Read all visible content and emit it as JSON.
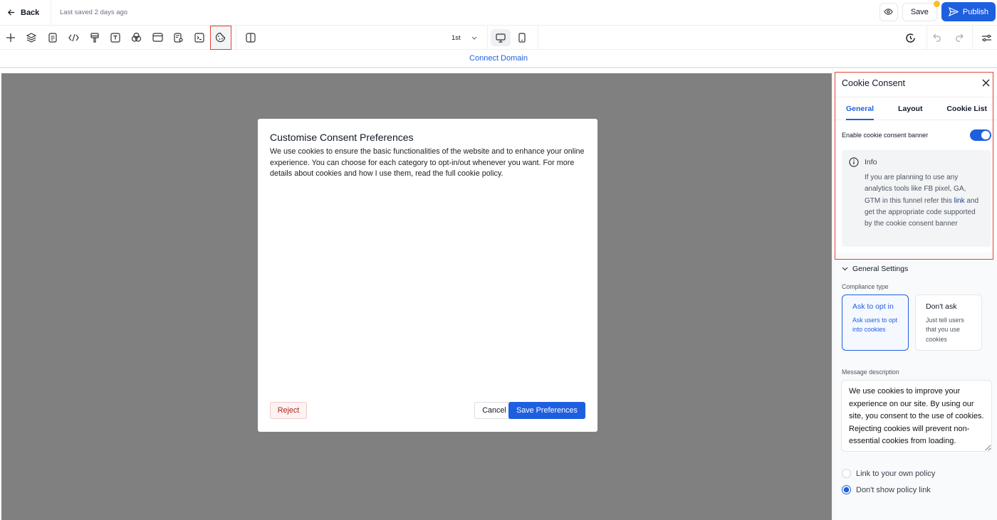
{
  "header": {
    "back_label": "Back",
    "last_saved": "Last saved 2 days ago",
    "save_label": "Save",
    "publish_label": "Publish"
  },
  "toolbar": {
    "tools": [
      "add-icon",
      "layers-icon",
      "page-icon",
      "code-icon",
      "brush-icon",
      "text-icon",
      "color-blend-icon",
      "layout-icon",
      "seo-icon",
      "terminal-icon",
      "cookie-icon",
      "split-view-icon"
    ],
    "active_tool": "cookie-icon",
    "page_select": "1st"
  },
  "domain_bar": {
    "link": "Connect Domain"
  },
  "modal": {
    "title": "Customise Consent Preferences",
    "body": "We use cookies to ensure the basic functionalities of the website and to enhance your online experience. You can choose for each category to opt-in/out whenever you want. For more details about cookies and how I use them, read the full cookie policy.",
    "reject": "Reject",
    "cancel": "Cancel",
    "save": "Save Preferences"
  },
  "panel": {
    "title": "Cookie Consent",
    "tabs": [
      "General",
      "Layout",
      "Cookie List"
    ],
    "active_tab": "General",
    "enable_label": "Enable cookie consent banner",
    "enable_on": true,
    "info": {
      "title": "Info",
      "text_before": "If you are planning to use any analytics tools like FB pixel, GA, GTM in this funnel refer this ",
      "link": "link",
      "text_after": " and get the appropriate code supported by the cookie consent banner"
    },
    "general_settings": "General Settings",
    "compliance_label": "Compliance type",
    "compliance": [
      {
        "title": "Ask to opt in",
        "desc": "Ask users to opt into cookies",
        "selected": true
      },
      {
        "title": "Don't ask",
        "desc": "Just tell users that you use cookies",
        "selected": false
      }
    ],
    "message_label": "Message description",
    "message": "We use cookies to improve your experience on our site. By using our site, you consent to the use of cookies. Rejecting cookies will prevent non-essential cookies from loading.",
    "policy_options": [
      {
        "label": "Link to your own policy",
        "selected": false
      },
      {
        "label": "Don't show policy link",
        "selected": true
      }
    ]
  },
  "colors": {
    "accent": "#1e5fe0",
    "highlight": "#e0432f",
    "canvas": "#808080"
  }
}
